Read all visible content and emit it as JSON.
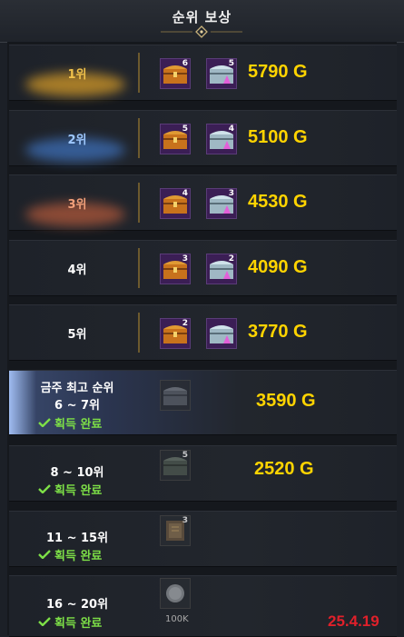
{
  "header": {
    "title": "순위 보상"
  },
  "colors": {
    "reward": "#ffd400",
    "done": "#7ddf47",
    "date": "#e0202a",
    "rank1": "#f1c24b",
    "rank2": "#9ec8ff",
    "rank3": "#f2a07a"
  },
  "rows": [
    {
      "rank": "1위",
      "chest_gold_qty": "6",
      "chest_silver_qty": "5",
      "reward": "5790 G"
    },
    {
      "rank": "2위",
      "chest_gold_qty": "5",
      "chest_silver_qty": "4",
      "reward": "5100 G"
    },
    {
      "rank": "3위",
      "chest_gold_qty": "4",
      "chest_silver_qty": "3",
      "reward": "4530 G"
    },
    {
      "rank": "4위",
      "chest_gold_qty": "3",
      "chest_silver_qty": "2",
      "reward": "4090 G"
    },
    {
      "rank": "5위",
      "chest_gold_qty": "2",
      "chest_silver_qty": "",
      "reward": "3770 G"
    },
    {
      "label": "금주 최고 순위",
      "rank": "6 ~ 7위",
      "status": "획득 완료",
      "reward": "3590 G"
    },
    {
      "rank": "8 ~ 10위",
      "status": "획득 완료",
      "item_qty": "5",
      "reward": "2520 G"
    },
    {
      "rank": "11 ~ 15위",
      "status": "획득 완료",
      "item_qty": "3"
    },
    {
      "rank": "16 ~ 20위",
      "status": "획득 완료",
      "item_label": "100K"
    }
  ],
  "date_stamp": "25.4.19"
}
